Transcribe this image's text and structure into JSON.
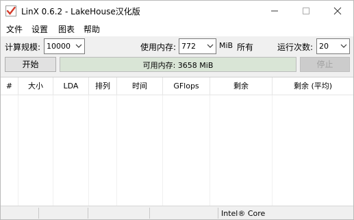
{
  "window": {
    "title": "LinX 0.6.2 - LakeHouse汉化版"
  },
  "menu": {
    "items": [
      "文件",
      "设置",
      "图表",
      "帮助"
    ]
  },
  "toolbar": {
    "problem_size_label": "计算规模:",
    "problem_size_value": "10000",
    "memory_label": "使用内存:",
    "memory_value": "772",
    "memory_unit": "MiB",
    "all_label": "所有",
    "runs_label": "运行次数:",
    "runs_value": "20"
  },
  "actions": {
    "start_label": "开始",
    "stop_label": "停止",
    "available_memory_text": "可用内存: 3658 MiB"
  },
  "table": {
    "columns": [
      "#",
      "大小",
      "LDA",
      "排列",
      "时间",
      "GFlops",
      "剩余",
      "剩余 (平均)"
    ]
  },
  "statusbar": {
    "cpu_text": "Intel® Core"
  },
  "colors": {
    "window_bg": "#f0f0f0",
    "progress_fill": "#d9e5d6",
    "disabled_text": "#a0a0a0"
  }
}
